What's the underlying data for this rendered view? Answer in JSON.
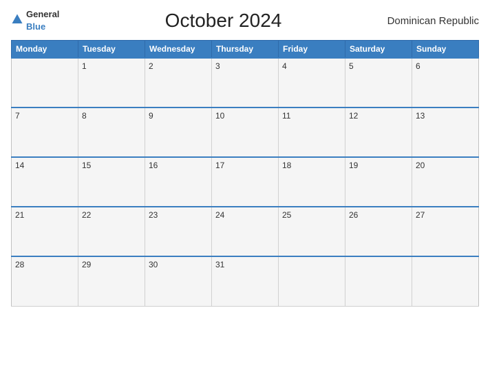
{
  "header": {
    "logo_general": "General",
    "logo_blue": "Blue",
    "title": "October 2024",
    "country": "Dominican Republic"
  },
  "days": [
    "Monday",
    "Tuesday",
    "Wednesday",
    "Thursday",
    "Friday",
    "Saturday",
    "Sunday"
  ],
  "weeks": [
    [
      "",
      "1",
      "2",
      "3",
      "4",
      "5",
      "6"
    ],
    [
      "7",
      "8",
      "9",
      "10",
      "11",
      "12",
      "13"
    ],
    [
      "14",
      "15",
      "16",
      "17",
      "18",
      "19",
      "20"
    ],
    [
      "21",
      "22",
      "23",
      "24",
      "25",
      "26",
      "27"
    ],
    [
      "28",
      "29",
      "30",
      "31",
      "",
      "",
      ""
    ]
  ]
}
